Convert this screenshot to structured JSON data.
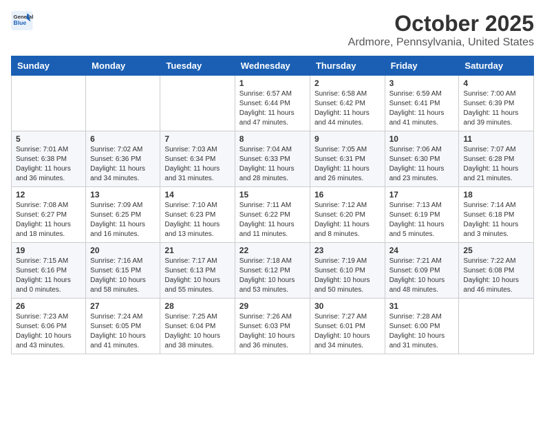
{
  "header": {
    "logo_line1": "General",
    "logo_line2": "Blue",
    "month": "October 2025",
    "location": "Ardmore, Pennsylvania, United States"
  },
  "weekdays": [
    "Sunday",
    "Monday",
    "Tuesday",
    "Wednesday",
    "Thursday",
    "Friday",
    "Saturday"
  ],
  "weeks": [
    [
      {
        "day": "",
        "info": ""
      },
      {
        "day": "",
        "info": ""
      },
      {
        "day": "",
        "info": ""
      },
      {
        "day": "1",
        "info": "Sunrise: 6:57 AM\nSunset: 6:44 PM\nDaylight: 11 hours\nand 47 minutes."
      },
      {
        "day": "2",
        "info": "Sunrise: 6:58 AM\nSunset: 6:42 PM\nDaylight: 11 hours\nand 44 minutes."
      },
      {
        "day": "3",
        "info": "Sunrise: 6:59 AM\nSunset: 6:41 PM\nDaylight: 11 hours\nand 41 minutes."
      },
      {
        "day": "4",
        "info": "Sunrise: 7:00 AM\nSunset: 6:39 PM\nDaylight: 11 hours\nand 39 minutes."
      }
    ],
    [
      {
        "day": "5",
        "info": "Sunrise: 7:01 AM\nSunset: 6:38 PM\nDaylight: 11 hours\nand 36 minutes."
      },
      {
        "day": "6",
        "info": "Sunrise: 7:02 AM\nSunset: 6:36 PM\nDaylight: 11 hours\nand 34 minutes."
      },
      {
        "day": "7",
        "info": "Sunrise: 7:03 AM\nSunset: 6:34 PM\nDaylight: 11 hours\nand 31 minutes."
      },
      {
        "day": "8",
        "info": "Sunrise: 7:04 AM\nSunset: 6:33 PM\nDaylight: 11 hours\nand 28 minutes."
      },
      {
        "day": "9",
        "info": "Sunrise: 7:05 AM\nSunset: 6:31 PM\nDaylight: 11 hours\nand 26 minutes."
      },
      {
        "day": "10",
        "info": "Sunrise: 7:06 AM\nSunset: 6:30 PM\nDaylight: 11 hours\nand 23 minutes."
      },
      {
        "day": "11",
        "info": "Sunrise: 7:07 AM\nSunset: 6:28 PM\nDaylight: 11 hours\nand 21 minutes."
      }
    ],
    [
      {
        "day": "12",
        "info": "Sunrise: 7:08 AM\nSunset: 6:27 PM\nDaylight: 11 hours\nand 18 minutes."
      },
      {
        "day": "13",
        "info": "Sunrise: 7:09 AM\nSunset: 6:25 PM\nDaylight: 11 hours\nand 16 minutes."
      },
      {
        "day": "14",
        "info": "Sunrise: 7:10 AM\nSunset: 6:23 PM\nDaylight: 11 hours\nand 13 minutes."
      },
      {
        "day": "15",
        "info": "Sunrise: 7:11 AM\nSunset: 6:22 PM\nDaylight: 11 hours\nand 11 minutes."
      },
      {
        "day": "16",
        "info": "Sunrise: 7:12 AM\nSunset: 6:20 PM\nDaylight: 11 hours\nand 8 minutes."
      },
      {
        "day": "17",
        "info": "Sunrise: 7:13 AM\nSunset: 6:19 PM\nDaylight: 11 hours\nand 5 minutes."
      },
      {
        "day": "18",
        "info": "Sunrise: 7:14 AM\nSunset: 6:18 PM\nDaylight: 11 hours\nand 3 minutes."
      }
    ],
    [
      {
        "day": "19",
        "info": "Sunrise: 7:15 AM\nSunset: 6:16 PM\nDaylight: 11 hours\nand 0 minutes."
      },
      {
        "day": "20",
        "info": "Sunrise: 7:16 AM\nSunset: 6:15 PM\nDaylight: 10 hours\nand 58 minutes."
      },
      {
        "day": "21",
        "info": "Sunrise: 7:17 AM\nSunset: 6:13 PM\nDaylight: 10 hours\nand 55 minutes."
      },
      {
        "day": "22",
        "info": "Sunrise: 7:18 AM\nSunset: 6:12 PM\nDaylight: 10 hours\nand 53 minutes."
      },
      {
        "day": "23",
        "info": "Sunrise: 7:19 AM\nSunset: 6:10 PM\nDaylight: 10 hours\nand 50 minutes."
      },
      {
        "day": "24",
        "info": "Sunrise: 7:21 AM\nSunset: 6:09 PM\nDaylight: 10 hours\nand 48 minutes."
      },
      {
        "day": "25",
        "info": "Sunrise: 7:22 AM\nSunset: 6:08 PM\nDaylight: 10 hours\nand 46 minutes."
      }
    ],
    [
      {
        "day": "26",
        "info": "Sunrise: 7:23 AM\nSunset: 6:06 PM\nDaylight: 10 hours\nand 43 minutes."
      },
      {
        "day": "27",
        "info": "Sunrise: 7:24 AM\nSunset: 6:05 PM\nDaylight: 10 hours\nand 41 minutes."
      },
      {
        "day": "28",
        "info": "Sunrise: 7:25 AM\nSunset: 6:04 PM\nDaylight: 10 hours\nand 38 minutes."
      },
      {
        "day": "29",
        "info": "Sunrise: 7:26 AM\nSunset: 6:03 PM\nDaylight: 10 hours\nand 36 minutes."
      },
      {
        "day": "30",
        "info": "Sunrise: 7:27 AM\nSunset: 6:01 PM\nDaylight: 10 hours\nand 34 minutes."
      },
      {
        "day": "31",
        "info": "Sunrise: 7:28 AM\nSunset: 6:00 PM\nDaylight: 10 hours\nand 31 minutes."
      },
      {
        "day": "",
        "info": ""
      }
    ]
  ]
}
